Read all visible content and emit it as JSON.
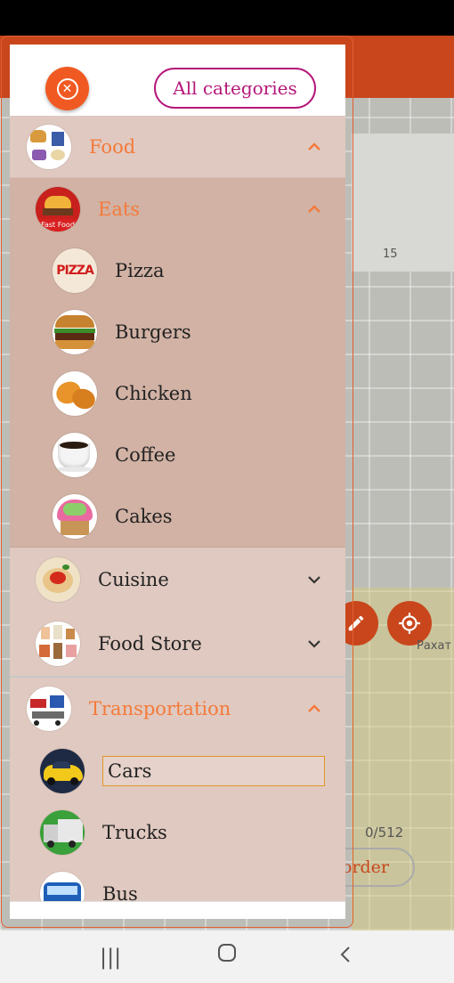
{
  "drawer": {
    "all_categories_label": "All categories",
    "close_icon": "close-circle-icon",
    "categories": [
      {
        "label": "Food",
        "expanded": true
      },
      {
        "label": "Eats",
        "expanded": true
      },
      {
        "label": "Pizza"
      },
      {
        "label": "Burgers"
      },
      {
        "label": "Chicken"
      },
      {
        "label": "Coffee"
      },
      {
        "label": "Cakes"
      },
      {
        "label": "Cuisine",
        "expanded": false
      },
      {
        "label": "Food Store",
        "expanded": false
      },
      {
        "label": "Transportation",
        "expanded": true
      },
      {
        "label": "Cars",
        "selected": true
      },
      {
        "label": "Trucks"
      },
      {
        "label": "Bus"
      }
    ]
  },
  "map": {
    "counter": "0/512",
    "order_label": "order",
    "place_label": "Рахат",
    "house_number": "15"
  },
  "colors": {
    "accent": "#f05a22",
    "brand_magenta": "#b5177a",
    "header_orange": "#c9461c"
  }
}
